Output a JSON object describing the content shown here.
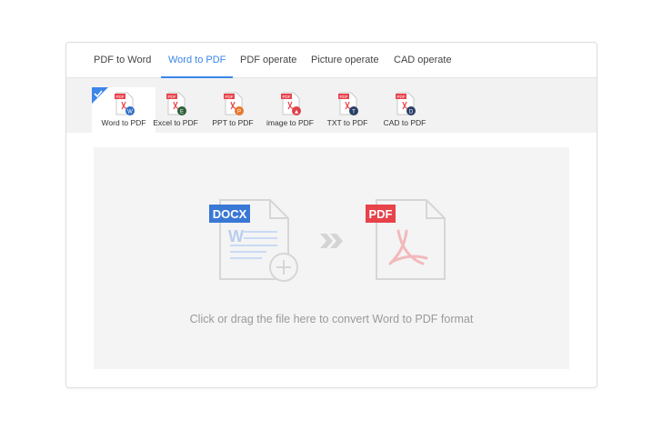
{
  "tabs": [
    {
      "label": "PDF to Word",
      "active": false
    },
    {
      "label": "Word to PDF",
      "active": true
    },
    {
      "label": "PDF operate",
      "active": false
    },
    {
      "label": "Picture operate",
      "active": false
    },
    {
      "label": "CAD operate",
      "active": false
    }
  ],
  "tools": [
    {
      "label": "Word to PDF",
      "icon": "word-badge-icon",
      "badge_color": "#2f6fc7",
      "badge_letter": "W",
      "selected": true
    },
    {
      "label": "Excel to PDF",
      "icon": "excel-badge-icon",
      "badge_color": "#2f5f3a",
      "badge_letter": "E",
      "selected": false
    },
    {
      "label": "PPT to PDF",
      "icon": "ppt-badge-icon",
      "badge_color": "#e8762c",
      "badge_letter": "P",
      "selected": false
    },
    {
      "label": "image to PDF",
      "icon": "image-badge-icon",
      "badge_color": "#e0404a",
      "badge_letter": "▲",
      "selected": false
    },
    {
      "label": "TXT to PDF",
      "icon": "txt-badge-icon",
      "badge_color": "#2a3f66",
      "badge_letter": "T",
      "selected": false
    },
    {
      "label": "CAD to PDF",
      "icon": "cad-badge-icon",
      "badge_color": "#2a3f66",
      "badge_letter": "D",
      "selected": false
    }
  ],
  "file_badge": "PDF",
  "dropzone": {
    "source_label": "DOCX",
    "target_label": "PDF",
    "hint": "Click or drag the file here to convert Word to PDF format"
  },
  "colors": {
    "accent": "#3b86e8",
    "pdf_red": "#e8424a",
    "docx_blue": "#3a78d6"
  }
}
